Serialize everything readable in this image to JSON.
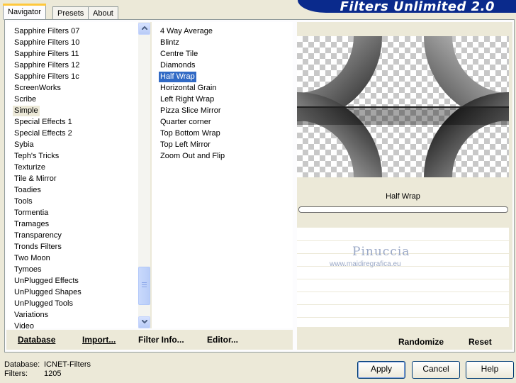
{
  "tabs": [
    "Navigator",
    "Presets",
    "About"
  ],
  "banner_title": "Filters Unlimited 2.0",
  "categories": [
    "Sapphire Filters 07",
    "Sapphire Filters 10",
    "Sapphire Filters 11",
    "Sapphire Filters 12",
    "Sapphire Filters 1c",
    "ScreenWorks",
    "Scribe",
    "Simple",
    "Special Effects 1",
    "Special Effects 2",
    "Sybia",
    "Teph's Tricks",
    "Texturize",
    "Tile & Mirror",
    "Toadies",
    "Tools",
    "Tormentia",
    "Tramages",
    "Transparency",
    "Tronds Filters",
    "Two Moon",
    "Tymoes",
    "UnPlugged Effects",
    "UnPlugged Shapes",
    "UnPlugged Tools",
    "Variations",
    "Video"
  ],
  "selected_category": "Simple",
  "filters": [
    "4 Way Average",
    "Blintz",
    "Centre Tile",
    "Diamonds",
    "Half Wrap",
    "Horizontal Grain",
    "Left Right Wrap",
    "Pizza Slice Mirror",
    "Quarter corner",
    "Top Bottom Wrap",
    "Top Left Mirror",
    "Zoom Out and Flip"
  ],
  "selected_filter": "Half Wrap",
  "preview": {
    "filter_name": "Half Wrap",
    "progress": 0
  },
  "watermark": {
    "name": "Pinuccia",
    "url": "www.maidiregrafica.eu"
  },
  "list_actions": {
    "database": "Database",
    "import": "Import...",
    "filter_info": "Filter Info...",
    "editor": "Editor..."
  },
  "preview_actions": {
    "randomize": "Randomize",
    "reset": "Reset"
  },
  "footer": {
    "database_label": "Database:",
    "database_value": "ICNET-Filters",
    "filters_label": "Filters:",
    "filters_value": "1205"
  },
  "buttons": {
    "apply": "Apply",
    "cancel": "Cancel",
    "help": "Help"
  }
}
